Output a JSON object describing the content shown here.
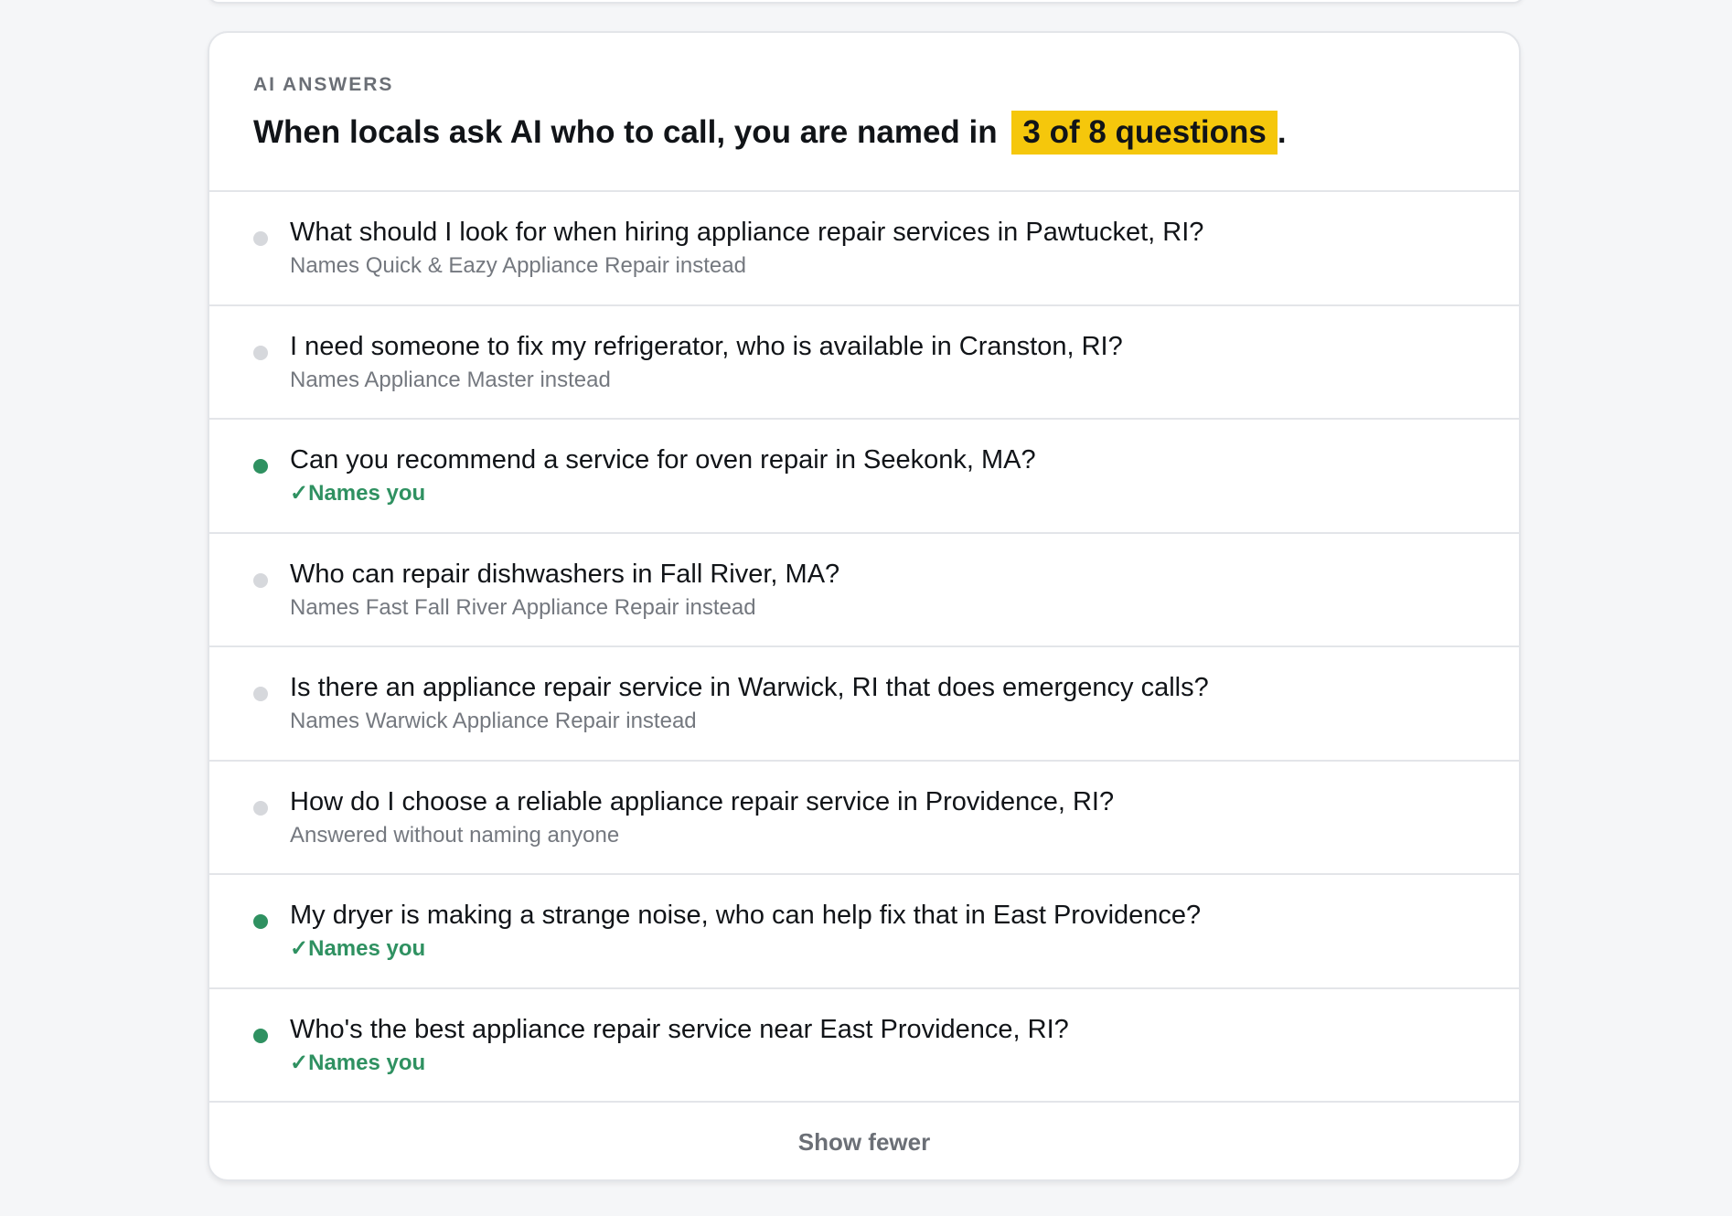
{
  "section": {
    "eyebrow": "AI ANSWERS",
    "headline_prefix": "When locals ask AI who to call, you are named in",
    "headline_highlight": "3 of 8 questions",
    "headline_suffix": "."
  },
  "summary": {
    "named_count": 3,
    "total_questions": 8
  },
  "questions": [
    {
      "status": "missed",
      "icon": "status-dot-gray",
      "question": "What should I look for when hiring appliance repair services in Pawtucket, RI?",
      "result": "Names Quick & Eazy Appliance Repair instead"
    },
    {
      "status": "missed",
      "icon": "status-dot-gray",
      "question": "I need someone to fix my refrigerator, who is available in Cranston, RI?",
      "result": "Names Appliance Master instead"
    },
    {
      "status": "named",
      "icon": "status-dot-green",
      "question": "Can you recommend a service for oven repair in Seekonk, MA?",
      "result": "✓Names you"
    },
    {
      "status": "missed",
      "icon": "status-dot-gray",
      "question": "Who can repair dishwashers in Fall River, MA?",
      "result": "Names Fast Fall River Appliance Repair instead"
    },
    {
      "status": "missed",
      "icon": "status-dot-gray",
      "question": "Is there an appliance repair service in Warwick, RI that does emergency calls?",
      "result": "Names Warwick Appliance Repair instead"
    },
    {
      "status": "missed",
      "icon": "status-dot-gray",
      "question": "How do I choose a reliable appliance repair service in Providence, RI?",
      "result": "Answered without naming anyone"
    },
    {
      "status": "named",
      "icon": "status-dot-green",
      "question": "My dryer is making a strange noise, who can help fix that in East Providence?",
      "result": "✓Names you"
    },
    {
      "status": "named",
      "icon": "status-dot-green",
      "question": "Who's the best appliance repair service near East Providence, RI?",
      "result": "✓Names you"
    }
  ],
  "footer": {
    "toggle_label": "Show fewer"
  },
  "colors": {
    "page_background": "#f5f6f8",
    "card_background": "#ffffff",
    "highlight": "#f5c70c",
    "named_green": "#2f9161",
    "missed_gray": "#d6d8dc",
    "muted_text": "#74787f"
  }
}
